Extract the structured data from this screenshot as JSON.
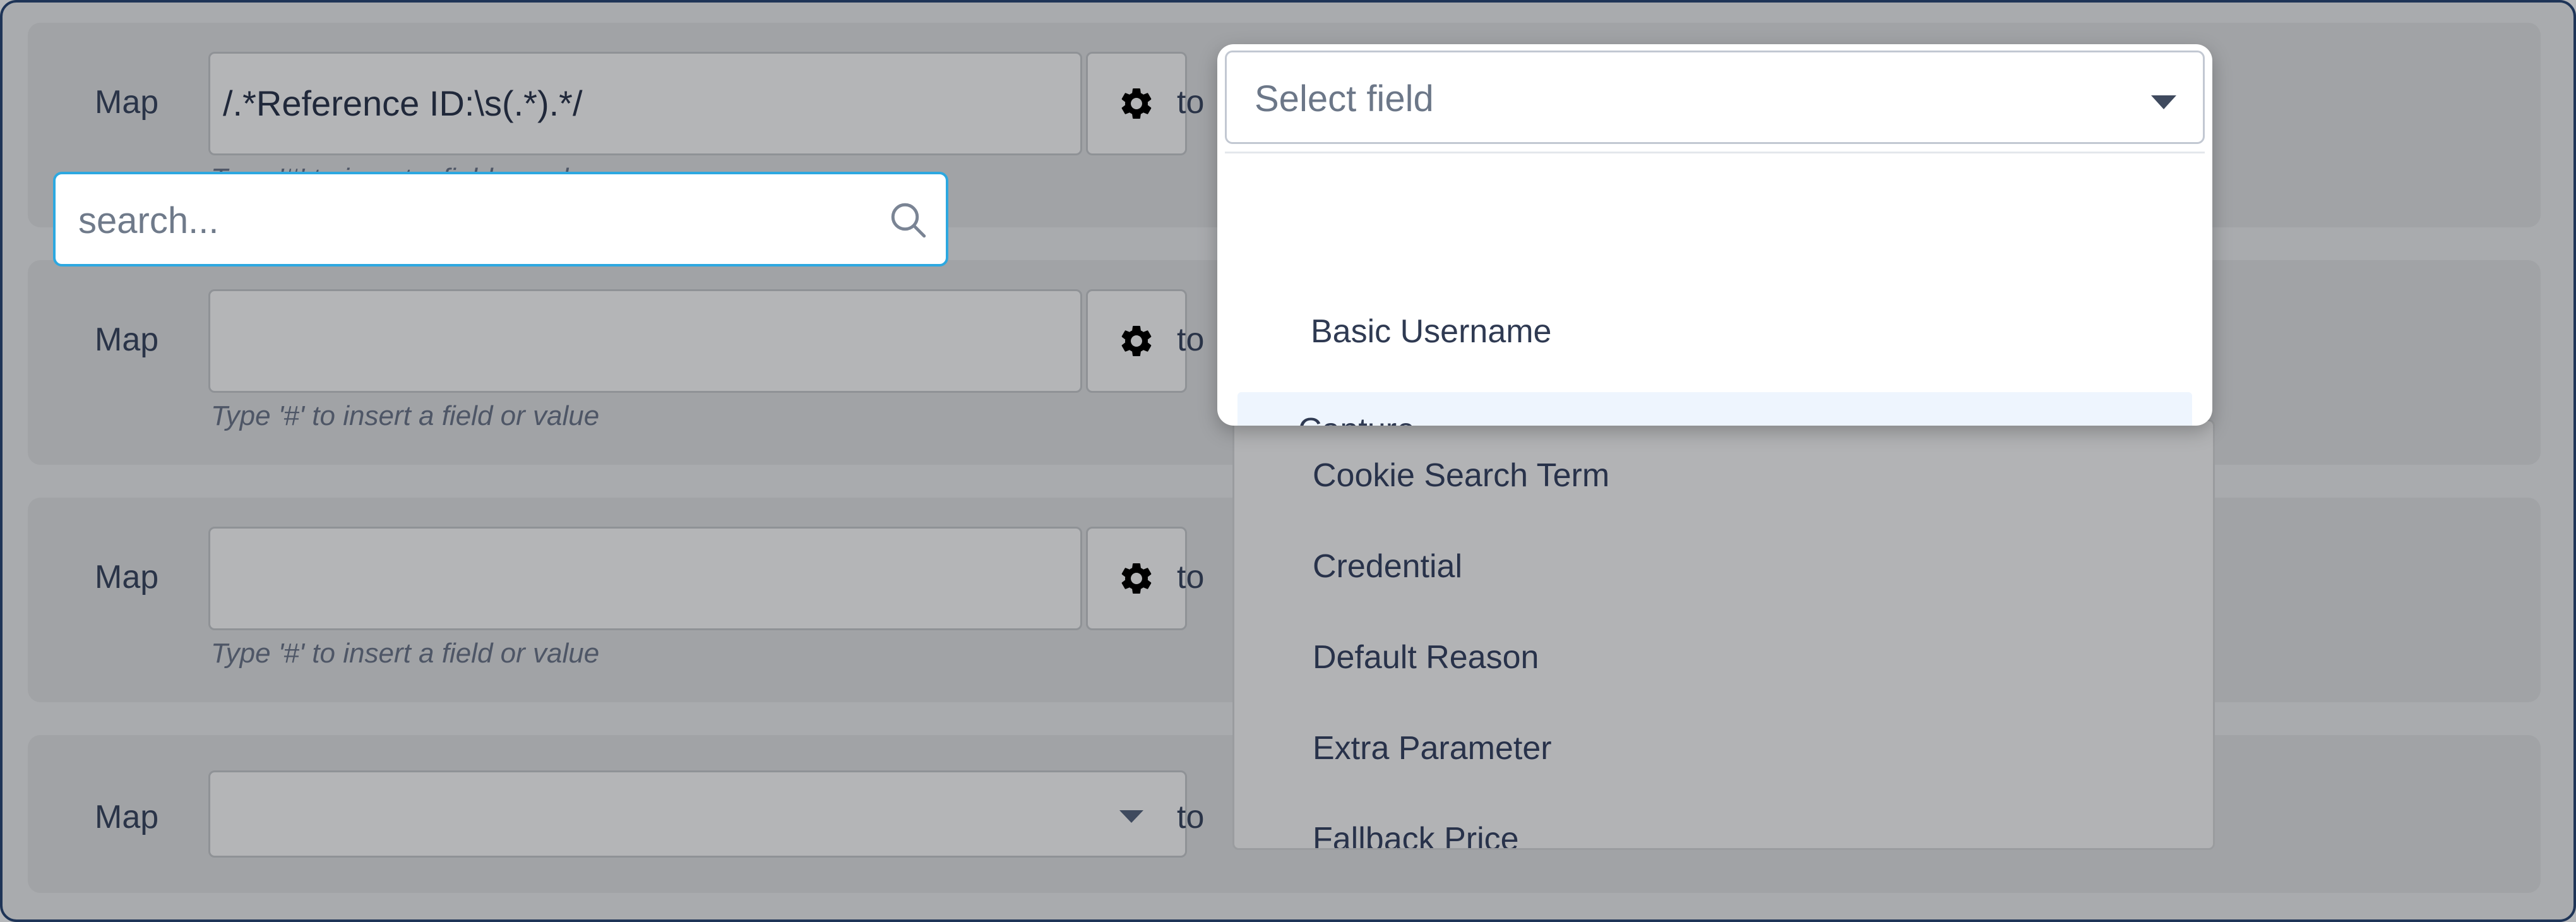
{
  "rows": [
    {
      "map_label": "Map",
      "input_value": "/.*Reference ID:\\s(.*).*/",
      "hint": "Type '#' to insert a field or value",
      "to_label": "to"
    },
    {
      "map_label": "Map",
      "input_value": "",
      "hint": "Type '#' to insert a field or value",
      "to_label": "to"
    },
    {
      "map_label": "Map",
      "input_value": "",
      "hint": "Type '#' to insert a field or value",
      "to_label": "to"
    },
    {
      "map_label": "Map",
      "select_value": "",
      "to_label": "to"
    }
  ],
  "dropdown": {
    "select_label": "Select field",
    "search_placeholder": "search...",
    "items": [
      "Basic Username",
      "Capture"
    ],
    "highlighted_item": "Capture"
  },
  "background_list": {
    "items": [
      "Cookie Search Term",
      "Credential",
      "Default Reason",
      "Extra Parameter",
      "Fallback Price"
    ]
  },
  "colors": {
    "accent": "#2da8e0",
    "highlight": "#eef5fe",
    "overlay": "#a9abae"
  },
  "icons": [
    "gear-icon",
    "chevron-down-icon",
    "search-icon"
  ]
}
